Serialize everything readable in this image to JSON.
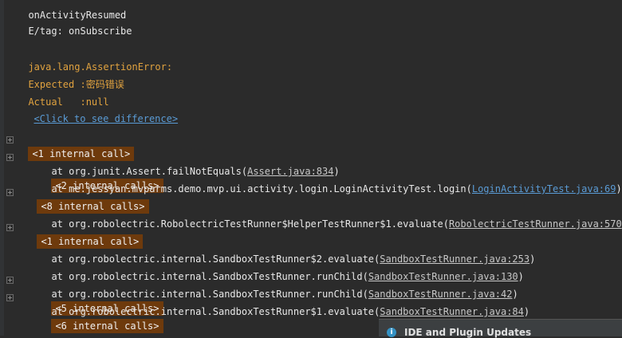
{
  "console": {
    "line_cut": "onActivityResumed",
    "line_tag": "E/tag: onSubscribe",
    "error_class": "java.lang.AssertionError:",
    "expected_label": "Expected :",
    "expected_value": "密码错误",
    "actual_label": "Actual   :",
    "actual_value": "null",
    "diff_link": "<Click to see difference>",
    "chip_1": "<1 internal call>",
    "frame_1_prefix": "at org.junit.Assert.failNotEquals(",
    "frame_1_link": "Assert.java:834",
    "frame_1_suffix": ")",
    "chip_2": "<2 internal calls>",
    "frame_2_prefix": "at me.jessyan.mvparms.demo.mvp.ui.activity.login.LoginActivityTest.login(",
    "frame_2_link": "LoginActivityTest.java:69",
    "frame_2_suffix": ")",
    "chip_8": "<8 internal calls>",
    "frame_3_prefix": "at org.robolectric.RobolectricTestRunner$HelperTestRunner$1.evaluate(",
    "frame_3_link": "RobolectricTestRunner.java:570",
    "frame_3_suffix": ")",
    "chip_1b": "<1 internal call>",
    "frame_4_prefix": "at org.robolectric.internal.SandboxTestRunner$2.evaluate(",
    "frame_4_link": "SandboxTestRunner.java:253",
    "frame_4_suffix": ")",
    "frame_5_prefix": "at org.robolectric.internal.SandboxTestRunner.runChild(",
    "frame_5_link": "SandboxTestRunner.java:130",
    "frame_5_suffix": ")",
    "frame_6_prefix": "at org.robolectric.internal.SandboxTestRunner.runChild(",
    "frame_6_link": "SandboxTestRunner.java:42",
    "frame_6_suffix": ")",
    "chip_5": "<5 internal calls>",
    "frame_7_prefix": "at org.robolectric.internal.SandboxTestRunner$1.evaluate(",
    "frame_7_link": "SandboxTestRunner.java:84",
    "frame_7_suffix": ")",
    "chip_6": "<6 internal calls>"
  },
  "notification": {
    "icon": "info-icon",
    "title": "IDE and Plugin Updates"
  }
}
